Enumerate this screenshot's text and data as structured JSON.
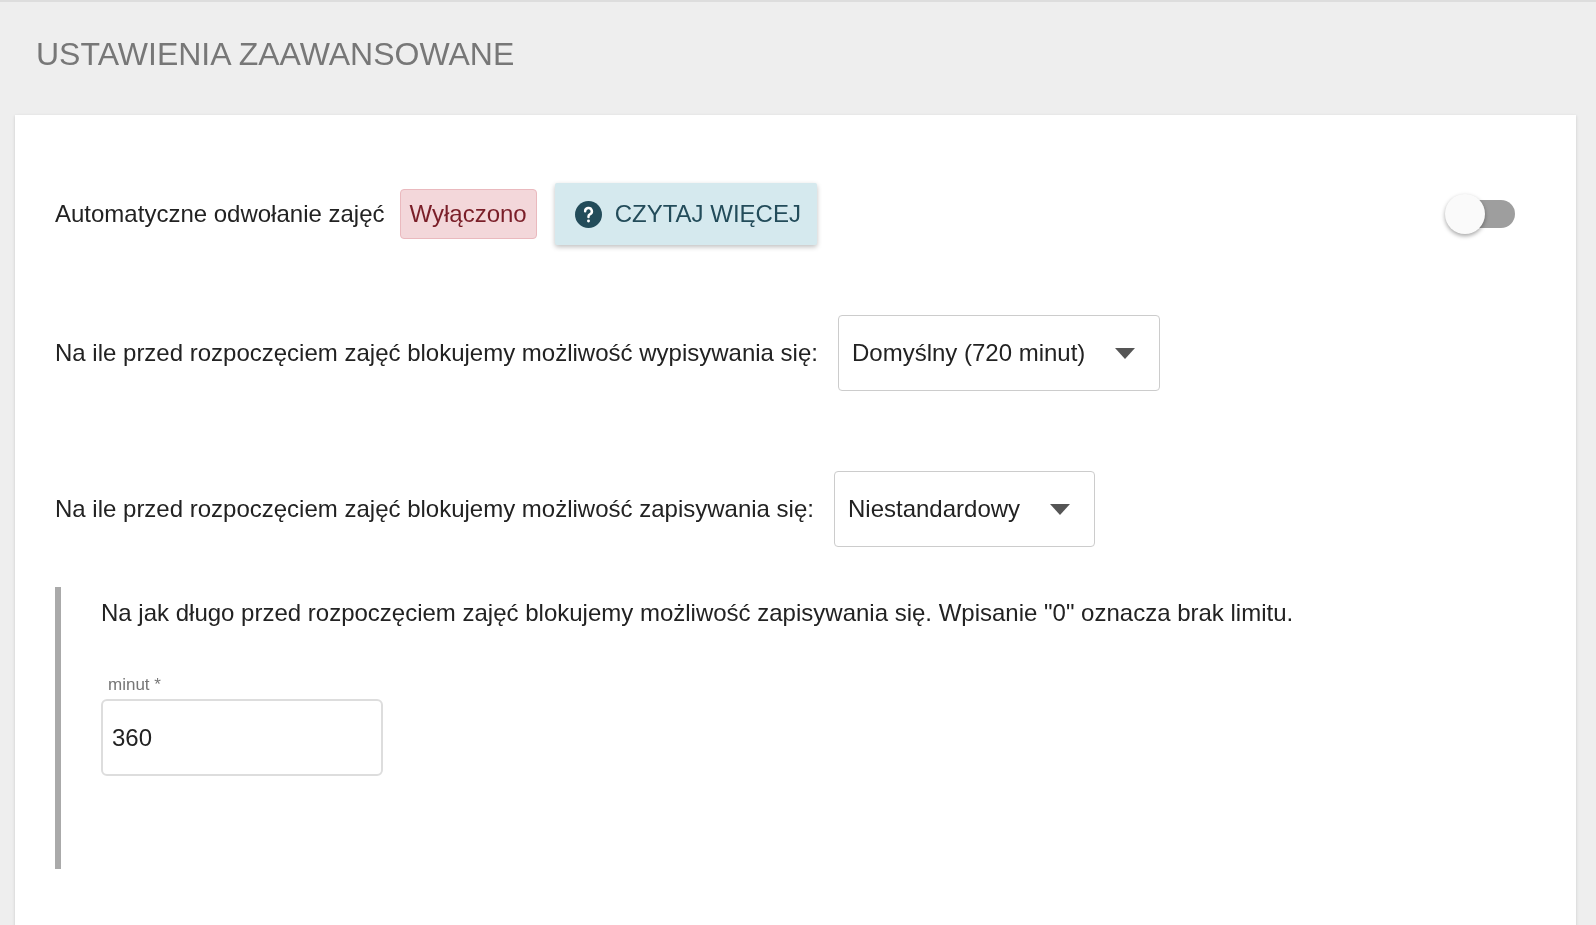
{
  "header": {
    "title": "USTAWIENIA ZAAWANSOWANE"
  },
  "auto_cancel": {
    "label": "Automatyczne odwołanie zajęć",
    "status": "Wyłączono",
    "button": "CZYTAJ WIĘCEJ",
    "on": false
  },
  "selects": [
    {
      "label": "Na ile przed rozpoczęciem zajęć blokujemy możliwość wypisywania się:",
      "value": "Domyślny (720 minut)"
    },
    {
      "label": "Na ile przed rozpoczęciem zajęć blokujemy możliwość zapisywania się:",
      "value": "Niestandardowy"
    }
  ],
  "custom": {
    "description": "Na jak długo przed rozpoczęciem zajęć blokujemy możliwość zapisywania się. Wpisanie \"0\" oznacza brak limitu.",
    "field_label": "minut *",
    "value": "360"
  }
}
